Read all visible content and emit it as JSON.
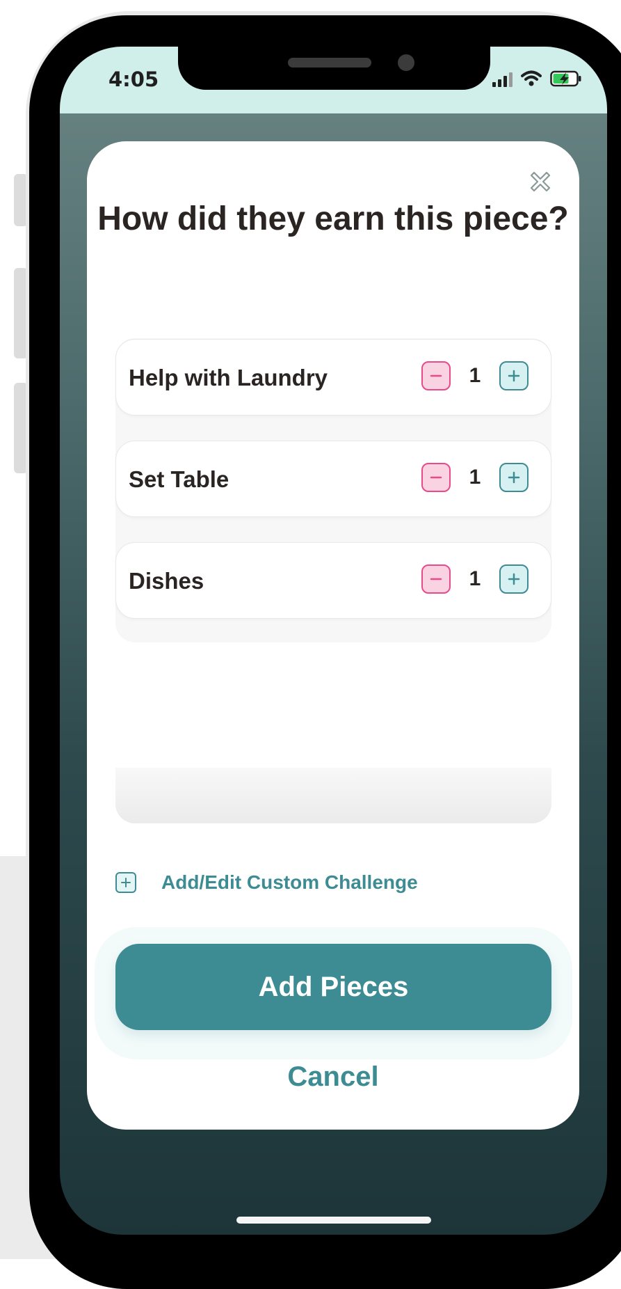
{
  "status_bar": {
    "time": "4:05"
  },
  "modal": {
    "title": "How did they earn this piece?",
    "close_icon": "close-x-icon",
    "challenges": [
      {
        "label": "Help with Laundry",
        "count": "1"
      },
      {
        "label": "Set Table",
        "count": "1"
      },
      {
        "label": "Dishes",
        "count": "1"
      }
    ],
    "custom_challenge_label": "Add/Edit Custom Challenge",
    "primary_button": "Add Pieces",
    "cancel_label": "Cancel"
  },
  "colors": {
    "accent": "#3e8c93",
    "minus_accent": "#e84a8c",
    "minus_fill": "#fad3e2",
    "plus_fill": "#d7f0f2",
    "status_bar_bg": "#d0eeea",
    "text": "#2a2422"
  }
}
